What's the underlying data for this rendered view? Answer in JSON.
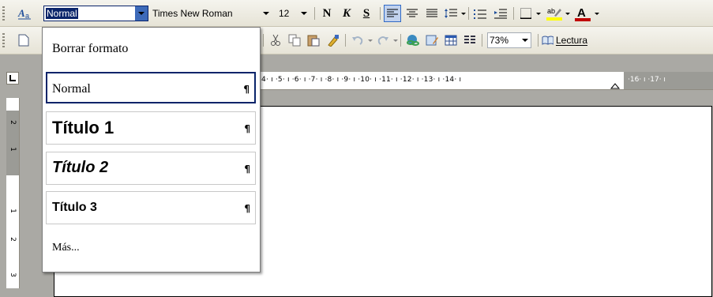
{
  "toolbar_top": {
    "style_value": "Normal",
    "font_value": "Times New Roman",
    "size_value": "12",
    "bold_label": "N",
    "italic_label": "K",
    "underline_label": "S"
  },
  "toolbar_std": {
    "zoom_value": "73%",
    "reading_label": "Lectura"
  },
  "ruler": {
    "marks": "·4· ı ·5· ı ·6· ı ·7· ı ·8· ı ·9· ı ·10· ı ·11· ı ·12· ı ·13· ı ·14· ı",
    "gray_marks": "·16· ı ·17· ı"
  },
  "vruler": {
    "n1": "2",
    "n2": "1",
    "n3": "1",
    "n4": "2",
    "n5": "3"
  },
  "style_menu": {
    "clear": "Borrar formato",
    "items": [
      {
        "label": "Normal",
        "mark": "¶"
      },
      {
        "label": "Título 1",
        "mark": "¶"
      },
      {
        "label": "Título 2",
        "mark": "¶"
      },
      {
        "label": "Título 3",
        "mark": "¶"
      }
    ],
    "more": "Más..."
  },
  "colors": {
    "highlight": "#ffff00",
    "font_color": "#c00000",
    "selection": "#0a246a"
  }
}
